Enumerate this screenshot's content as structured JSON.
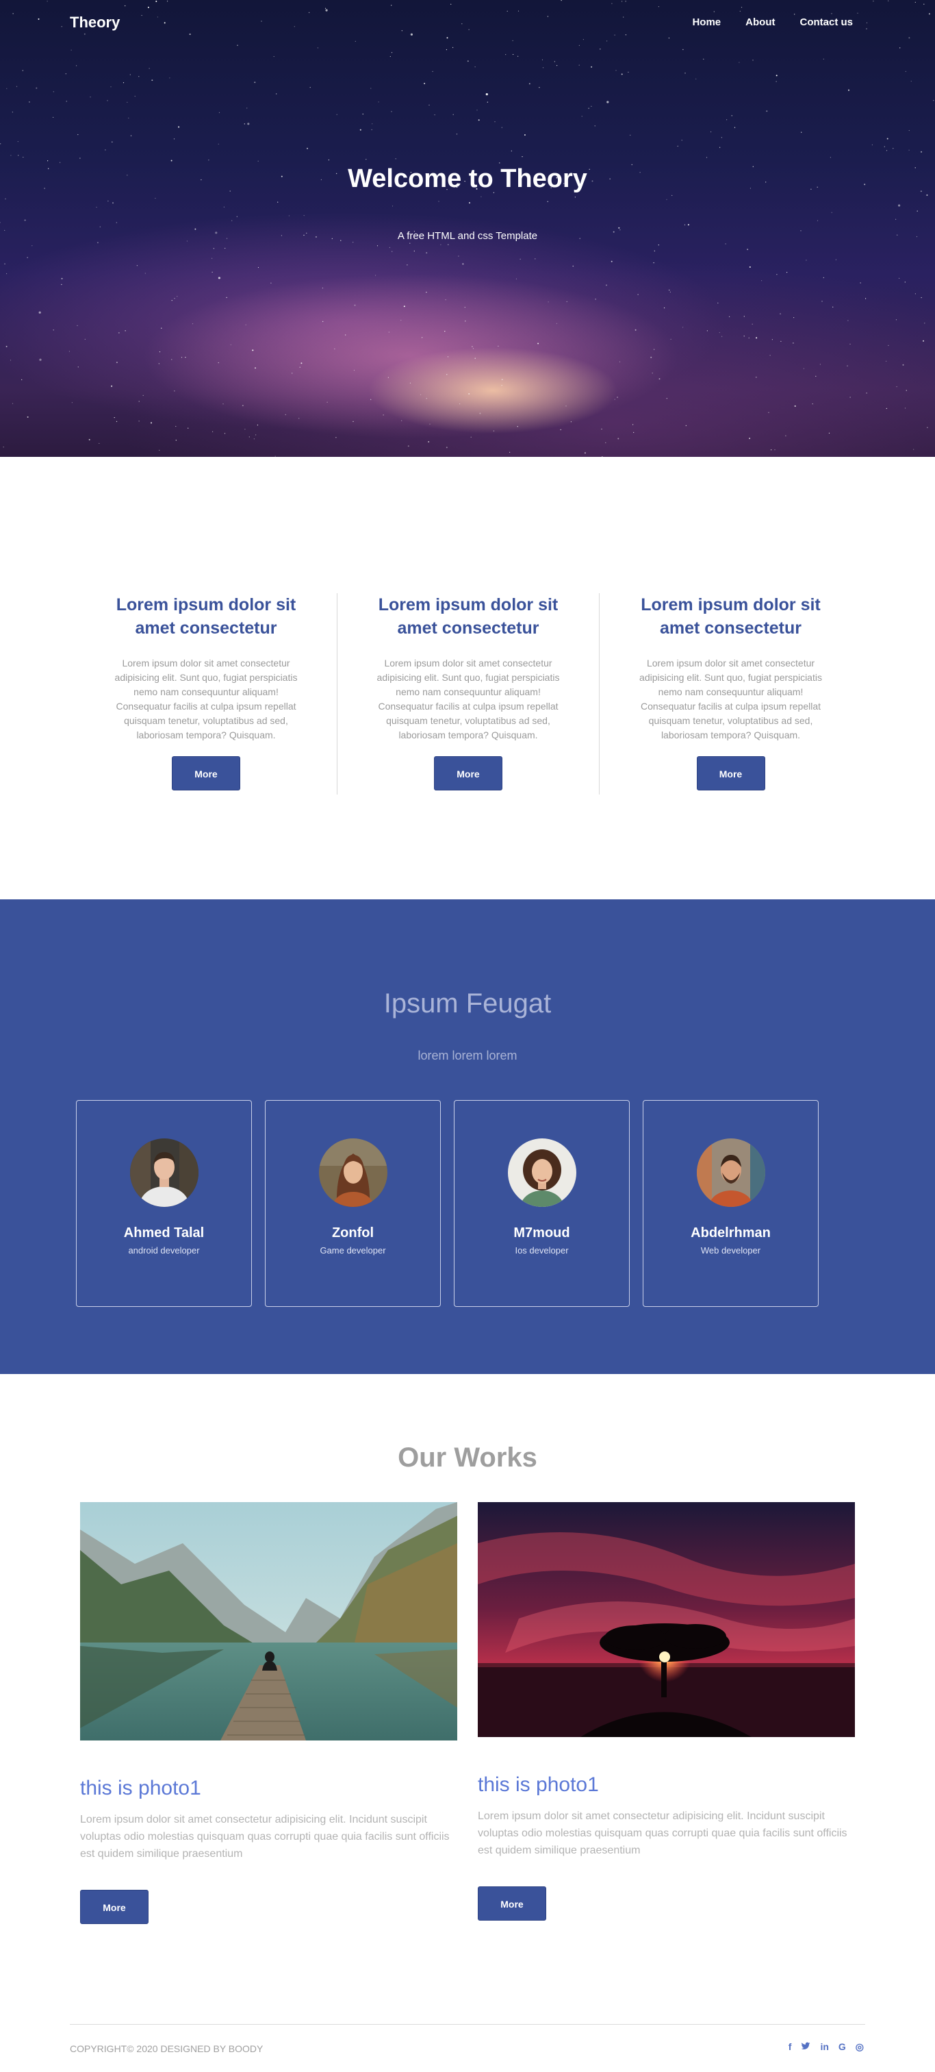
{
  "nav": {
    "brand": "Theory",
    "links": [
      "Home",
      "About",
      "Contact us"
    ]
  },
  "hero": {
    "title": "Welcome to Theory",
    "subtitle": "A free HTML and css Template"
  },
  "features": [
    {
      "title": "Lorem ipsum dolor sit amet consectetur",
      "text": "Lorem ipsum dolor sit amet consectetur adipisicing elit. Sunt quo, fugiat perspiciatis nemo nam consequuntur aliquam! Consequatur facilis at culpa ipsum repellat quisquam tenetur, voluptatibus ad sed, laboriosam tempora? Quisquam.",
      "button": "More"
    },
    {
      "title": "Lorem ipsum dolor sit amet consectetur",
      "text": "Lorem ipsum dolor sit amet consectetur adipisicing elit. Sunt quo, fugiat perspiciatis nemo nam consequuntur aliquam! Consequatur facilis at culpa ipsum repellat quisquam tenetur, voluptatibus ad sed, laboriosam tempora? Quisquam.",
      "button": "More"
    },
    {
      "title": "Lorem ipsum dolor sit amet consectetur",
      "text": "Lorem ipsum dolor sit amet consectetur adipisicing elit. Sunt quo, fugiat perspiciatis nemo nam consequuntur aliquam! Consequatur facilis at culpa ipsum repellat quisquam tenetur, voluptatibus ad sed, laboriosam tempora? Quisquam.",
      "button": "More"
    }
  ],
  "team": {
    "title": "Ipsum Feugat",
    "subtitle": "lorem lorem lorem",
    "members": [
      {
        "name": "Ahmed Talal",
        "role": "android developer"
      },
      {
        "name": "Zonfol",
        "role": "Game developer"
      },
      {
        "name": "M7moud",
        "role": "Ios developer"
      },
      {
        "name": "Abdelrhman",
        "role": "Web developer"
      }
    ]
  },
  "works": {
    "title": "Our Works",
    "items": [
      {
        "title": "this is photo1",
        "text": "Lorem ipsum dolor sit amet consectetur adipisicing elit. Incidunt suscipit voluptas odio molestias quisquam quas corrupti quae quia facilis sunt officiis est quidem similique praesentium",
        "button": "More"
      },
      {
        "title": "this is photo1",
        "text": "Lorem ipsum dolor sit amet consectetur adipisicing elit. Incidunt suscipit voluptas odio molestias quisquam quas corrupti quae quia facilis sunt officiis est quidem similique praesentium",
        "button": "More"
      }
    ]
  },
  "footer": {
    "copyright": "COPYRIGHT© 2020 DESIGNED BY BOODY",
    "social_icons": [
      {
        "name": "facebook-icon",
        "glyph": "f"
      },
      {
        "name": "twitter-icon",
        "glyph": "🐦"
      },
      {
        "name": "linkedin-icon",
        "glyph": "in"
      },
      {
        "name": "google-icon",
        "glyph": "G"
      },
      {
        "name": "dribbble-icon",
        "glyph": "◎"
      }
    ]
  },
  "colors": {
    "primary": "#3a529a",
    "accent_link": "#5b78d6",
    "muted_text": "#9a9a9a"
  }
}
